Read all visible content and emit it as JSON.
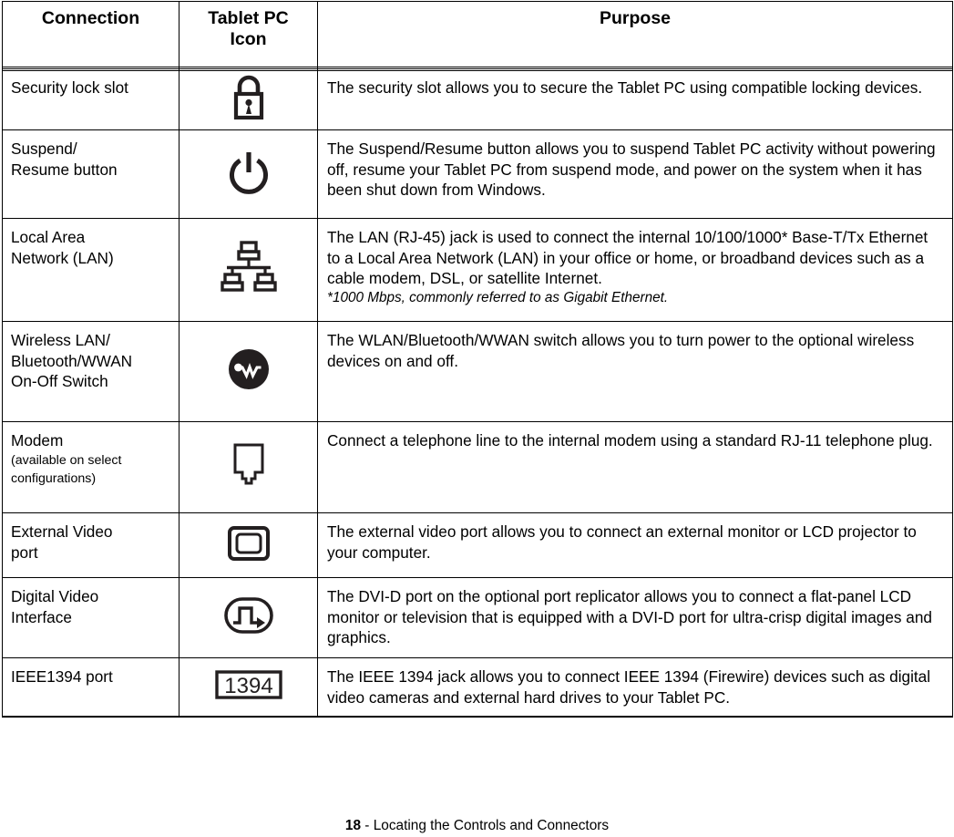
{
  "document": {
    "title": "Locating the Controls and Connectors",
    "page_number": "18",
    "footer_separator": " - ",
    "footer_text": "Locating the Controls and Connectors"
  },
  "table": {
    "headers": [
      {
        "label": "Connection",
        "name": "connection"
      },
      {
        "label": "Tablet PC Icon",
        "line1": "Tablet PC",
        "line2": "Icon",
        "name": "tablet-pc-icon"
      },
      {
        "label": "Purpose",
        "name": "purpose"
      }
    ],
    "rows": [
      {
        "connection": "Security lock slot",
        "icon": "padlock-icon",
        "purpose": "The security slot allows you to secure the Tablet PC using compatible locking devices."
      },
      {
        "connection": "Suspend/\nResume button",
        "connection_line1": "Suspend/",
        "connection_line2": "Resume button",
        "icon": "power-button-icon",
        "purpose": "The Suspend/Resume button allows you to suspend Tablet PC activity without powering off, resume your Tablet PC from suspend mode, and power on the system when it has been shut down from Windows."
      },
      {
        "connection": "Local Area Network (LAN)",
        "connection_line1": "Local Area",
        "connection_line2": "Network (LAN)",
        "icon": "network-lan-icon",
        "purpose": "The LAN (RJ-45) jack is used to connect the internal 10/100/1000* Base-T/Tx Ethernet to a Local Area Network (LAN) in your office or home, or broadband devices such as a cable modem, DSL, or satellite Internet.",
        "footnote": "*1000 Mbps, commonly referred to as Gigabit Ethernet."
      },
      {
        "connection": "Wireless LAN/Bluetooth/WWAN On-Off Switch",
        "connection_line1": "Wireless LAN/",
        "connection_line2": "Bluetooth/WWAN",
        "connection_line3": "On-Off Switch",
        "icon": "wireless-switch-icon",
        "purpose": "The WLAN/Bluetooth/WWAN switch allows you to turn power to the optional wireless devices on and off."
      },
      {
        "connection": "Modem",
        "connection_note": "(available on select configurations)",
        "icon": "modem-jack-icon",
        "purpose": "Connect a telephone line to the internal modem using a standard RJ-11 telephone plug."
      },
      {
        "connection": "External Video port",
        "connection_line1": "External Video",
        "connection_line2": "port",
        "icon": "external-monitor-icon",
        "purpose": "The external video port allows you to connect an external monitor or LCD projector to your computer."
      },
      {
        "connection": "Digital Video Interface",
        "connection_line1": "Digital Video",
        "connection_line2": "Interface",
        "icon": "dvi-port-icon",
        "purpose": "The DVI-D port on the optional port replicator allows you to connect a flat-panel LCD monitor or television that is equipped with a DVI-D port for ultra-crisp digital images and graphics."
      },
      {
        "connection": "IEEE1394 port",
        "icon": "ieee1394-icon",
        "icon_label": "1394",
        "purpose": "The IEEE 1394 jack allows you to connect IEEE 1394 (Firewire) devices such as digital video cameras and external hard drives to your Tablet PC."
      }
    ]
  },
  "colors": {
    "ink": "#000000",
    "icon_dark": "#231f20",
    "page_background": "#ffffff"
  }
}
